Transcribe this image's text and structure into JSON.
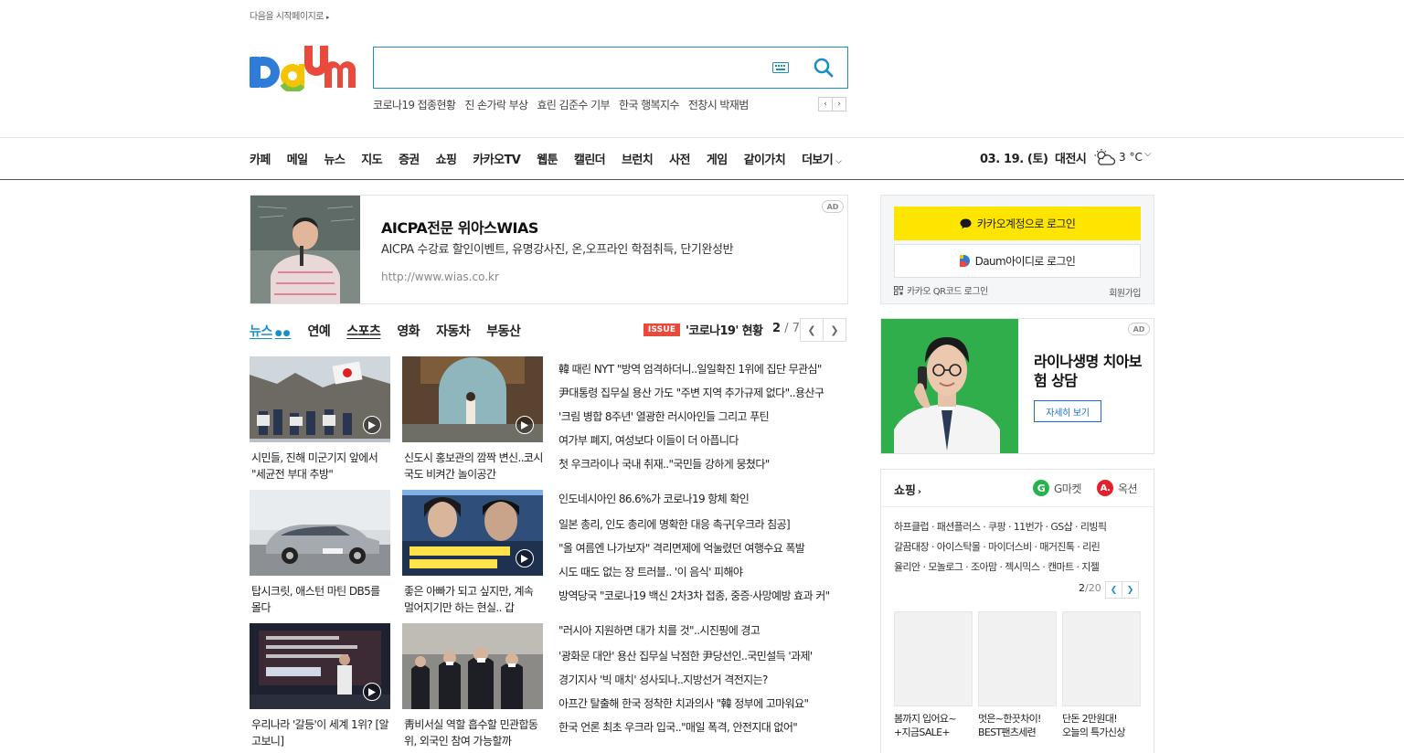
{
  "top": {
    "start_page": "다음을 시작페이지로"
  },
  "logo": {
    "text": "Daum"
  },
  "search": {
    "value": "",
    "placeholder": ""
  },
  "trending": [
    "코로나19 접종현황",
    "진 손가락 부상",
    "효린 김준수 기부",
    "한국 행복지수",
    "전창시 박재범"
  ],
  "gnb": {
    "items": [
      "카페",
      "메일",
      "뉴스",
      "지도",
      "증권",
      "쇼핑",
      "카카오TV",
      "웹툰",
      "캘린더",
      "브런치",
      "사전",
      "게임",
      "같이가치"
    ],
    "more": "더보기",
    "date": "03. 19. (토)",
    "region": "대전시",
    "temp": "3 °C"
  },
  "ad_banner": {
    "title": "AICPA전문 위아스WIAS",
    "desc": "AICPA 수강료 할인이벤트, 유명강사진, 온,오프라인 학점취득, 단기완성반",
    "url": "http://www.wias.co.kr",
    "badge": "AD"
  },
  "news_tabs": {
    "items": [
      "뉴스",
      "연예",
      "스포츠",
      "영화",
      "자동차",
      "부동산"
    ],
    "issue_badge": "ISSUE",
    "issue_text": "'코로나19' 현황",
    "page_current": "2",
    "page_total": "/ 7"
  },
  "thumbs": [
    {
      "caption": "시민들, 진해 미군기지 앞에서 \"세균전 부대 추방\""
    },
    {
      "caption": "신도시 홍보관의 깜짝 변신..코시국도 비켜간 놀이공간"
    },
    {
      "caption": "탑시크릿, 애스턴 마틴 DB5를 몰다"
    },
    {
      "caption": "좋은 아빠가 되고 싶지만, 계속 멀어지기만 하는 현실.. 갑"
    },
    {
      "caption": "우리나라 '갈등'이 세계 1위? [알고보니]"
    },
    {
      "caption": "靑비서실 역할 흡수할 민관합동위, 외국인 참여 가능할까"
    }
  ],
  "headlines_1": [
    "韓 때린 NYT \"방역 엄격하더니..일일확진 1위에 집단 무관심\"",
    "尹대통령 집무실 용산 가도 \"주변 지역 추가규제 없다\"..용산구",
    "'크림 병합 8주년' 열광한 러시아인들 그리고 푸틴",
    "여가부 폐지, 여성보다 이들이 더 아픕니다",
    "첫 우크라이나 국내 취재..\"국민들 강하게 뭉쳤다\""
  ],
  "headlines_2": [
    "인도네시아인 86.6%가 코로나19 항체 확인",
    "일본 총리, 인도 총리에 명확한 대응 촉구[우크라 침공]",
    "\"올 여름엔 나가보자\" 격리면제에 억눌렸던 여행수요 폭발",
    "시도 때도 없는 장 트러블.. '이 음식' 피해야",
    "방역당국 \"코로나19 백신 2차3차 접종, 중증·사망예방 효과 커\""
  ],
  "headlines_3": [
    "\"러시아 지원하면 대가 치를 것\"..시진핑에 경고",
    "'광화문 대안' 용산 집무실 낙점한 尹당선인..국민설득 '과제'",
    "경기지사 '빅 매치' 성사되나..지방선거 격전지는?",
    "아프간 탈출해 한국 정착한 치과의사 \"韓 정부에 고마워요\"",
    "한국 언론 최초 우크라 입국..\"매일 폭격, 안전지대 없어\""
  ],
  "login": {
    "kakao": "카카오계정으로 로그인",
    "daum": "Daum아이디로 로그인",
    "qr": "카카오 QR코드 로그인",
    "signup": "회원가입"
  },
  "ad2": {
    "title": "라이나생명 치아보험 상담",
    "button": "자세히 보기",
    "badge": "AD"
  },
  "shop": {
    "title": "쇼핑",
    "gmarket": "G마켓",
    "auction": "옥션",
    "links": [
      "하프클럽 · 패션플러스 · 쿠팡 · 11번가 · GS샵 · 리빙픽",
      "갈끔대장 · 아이스탁몰 · 마이더스비 · 매거진톡 · 리린",
      "율리안 · 모놀로그 · 조아맘 · 젝시믹스 · 캔마트 · 지젤"
    ],
    "page_current": "2",
    "page_total": "/20",
    "items": [
      {
        "line1": "봄까지 입어요~",
        "line2": "+지금SALE+"
      },
      {
        "line1": "멋은~한끗차이!",
        "line2": "BEST팬츠세련"
      },
      {
        "line1": "단돈 2만원대!",
        "line2": "오늘의 특가신상"
      }
    ]
  },
  "colors": {
    "accent": "#1b8ec5",
    "kakao": "#fee500",
    "issue": "#e84a3b"
  }
}
